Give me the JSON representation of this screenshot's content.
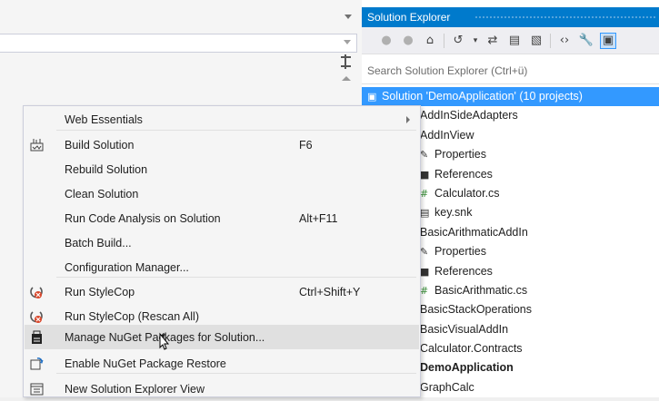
{
  "solution_explorer": {
    "title": "Solution Explorer",
    "search_placeholder": "Search Solution Explorer (Ctrl+ü)",
    "toolbar_icons": [
      "back-icon",
      "forward-icon",
      "home-icon",
      "history-icon",
      "sync-icon",
      "collapse-all-icon",
      "show-all-files-icon",
      "view-code-icon",
      "properties-icon",
      "preview-icon"
    ],
    "tree": [
      {
        "label": "Solution 'DemoApplication' (10 projects)",
        "selected": true
      },
      {
        "label": "AddInSideAdapters"
      },
      {
        "label": "AddInView"
      },
      {
        "label": "Properties"
      },
      {
        "label": "References"
      },
      {
        "label": "Calculator.cs"
      },
      {
        "label": "key.snk"
      },
      {
        "label": "BasicArithmaticAddIn"
      },
      {
        "label": "Properties"
      },
      {
        "label": "References"
      },
      {
        "label": "BasicArithmatic.cs"
      },
      {
        "label": "BasicStackOperations"
      },
      {
        "label": "BasicVisualAddIn"
      },
      {
        "label": "Calculator.Contracts"
      },
      {
        "label": "DemoApplication",
        "bold": true
      },
      {
        "label": "GraphCalc"
      }
    ]
  },
  "context_menu": {
    "items": [
      {
        "label": "Web Essentials",
        "shortcut": "",
        "icon": "",
        "submenu": true
      },
      {
        "label": "Build Solution",
        "shortcut": "F6",
        "icon": "build-icon"
      },
      {
        "label": "Rebuild Solution",
        "shortcut": "",
        "icon": ""
      },
      {
        "label": "Clean Solution",
        "shortcut": "",
        "icon": ""
      },
      {
        "label": "Run Code Analysis on Solution",
        "shortcut": "Alt+F11",
        "icon": ""
      },
      {
        "label": "Batch Build...",
        "shortcut": "",
        "icon": ""
      },
      {
        "label": "Configuration Manager...",
        "shortcut": "",
        "icon": ""
      },
      {
        "label": "Run StyleCop",
        "shortcut": "Ctrl+Shift+Y",
        "icon": "stylecop-icon"
      },
      {
        "label": "Run StyleCop (Rescan All)",
        "shortcut": "",
        "icon": "stylecop-icon"
      },
      {
        "label": "Manage NuGet Packages for Solution...",
        "shortcut": "",
        "icon": "nuget-icon",
        "hover": true
      },
      {
        "label": "Enable NuGet Package Restore",
        "shortcut": "",
        "icon": "package-restore-icon"
      },
      {
        "label": "New Solution Explorer View",
        "shortcut": "",
        "icon": "new-view-icon"
      }
    ]
  },
  "colors": {
    "accent": "#007acc",
    "selection": "#3399ff",
    "menu_bg": "#f5f5f5",
    "stylecop_red": "#d9472b"
  }
}
